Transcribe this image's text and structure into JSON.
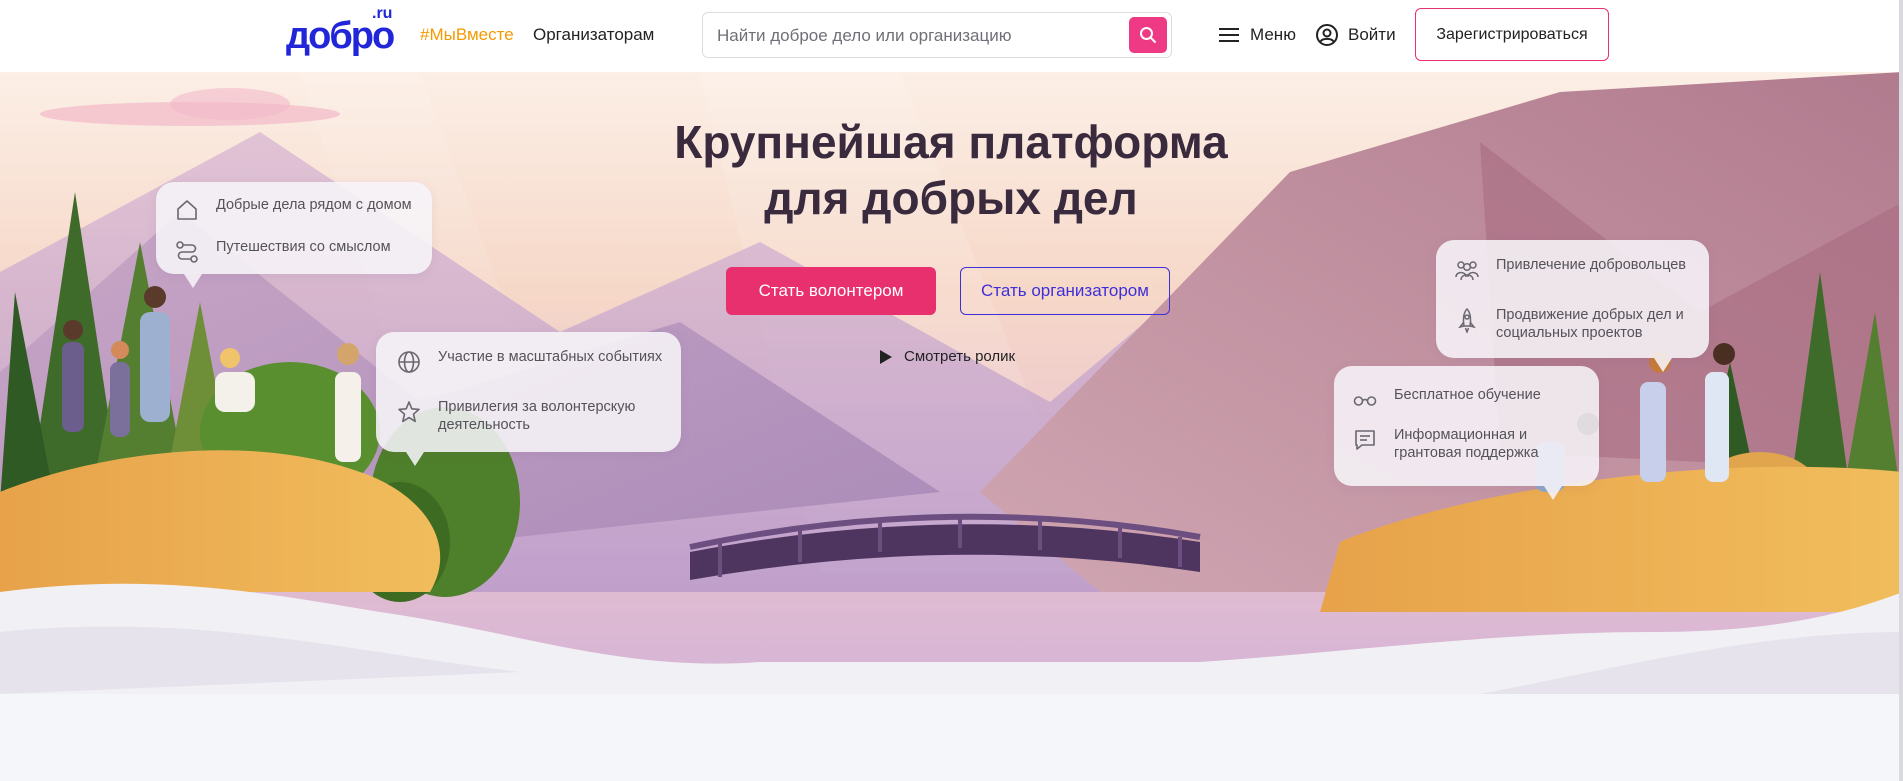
{
  "header": {
    "logo_text": "добро",
    "logo_suffix": ".ru",
    "hashtag_link": "#МыВместе",
    "organizers_link": "Организаторам",
    "search_placeholder": "Найти доброе дело или организацию",
    "menu_label": "Меню",
    "login_label": "Войти",
    "register_label": "Зарегистрироваться"
  },
  "hero": {
    "title_line1": "Крупнейшая платформа",
    "title_line2": "для добрых дел",
    "volunteer_button": "Стать волонтером",
    "organizer_button": "Стать организатором",
    "watch_video": "Смотреть ролик"
  },
  "cards": {
    "card1": [
      {
        "icon": "home-icon",
        "text": "Добрые дела рядом с домом"
      },
      {
        "icon": "route-icon",
        "text": "Путешествия со смыслом"
      }
    ],
    "card2": [
      {
        "icon": "globe-icon",
        "text": "Участие в масштабных событиях"
      },
      {
        "icon": "star-icon",
        "text": "Привилегия за волонтерскую деятельность"
      }
    ],
    "card3": [
      {
        "icon": "people-icon",
        "text": "Привлечение добровольцев"
      },
      {
        "icon": "rocket-icon",
        "text": "Продвижение добрых дел и социальных проектов"
      }
    ],
    "card4": [
      {
        "icon": "glasses-icon",
        "text": "Бесплатное обучение"
      },
      {
        "icon": "message-icon",
        "text": "Информационная и грантовая поддержка"
      }
    ]
  },
  "colors": {
    "brand_blue": "#2126d9",
    "accent_pink": "#e8306e",
    "hashtag_orange": "#f29a00",
    "organizer_purple": "#3f2fd8"
  }
}
